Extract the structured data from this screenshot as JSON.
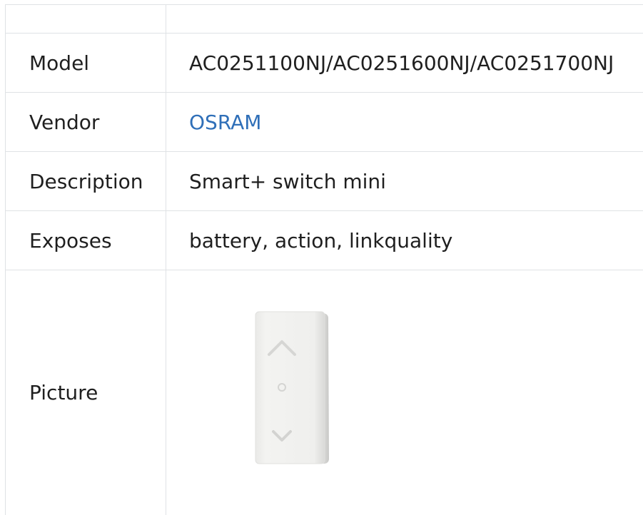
{
  "rows": [
    {
      "key": "",
      "value": ""
    },
    {
      "key": "Model",
      "value": "AC0251100NJ/AC0251600NJ/AC0251700NJ"
    },
    {
      "key": "Vendor",
      "value": "OSRAM"
    },
    {
      "key": "Description",
      "value": "Smart+ switch mini"
    },
    {
      "key": "Exposes",
      "value": "battery, action, linkquality"
    },
    {
      "key": "Picture"
    }
  ],
  "colors": {
    "border": "#dfe2e5",
    "link": "#2f6fb8",
    "text": "#1f1f1f"
  },
  "picture": {
    "icon": "switch-mini-device-image"
  }
}
